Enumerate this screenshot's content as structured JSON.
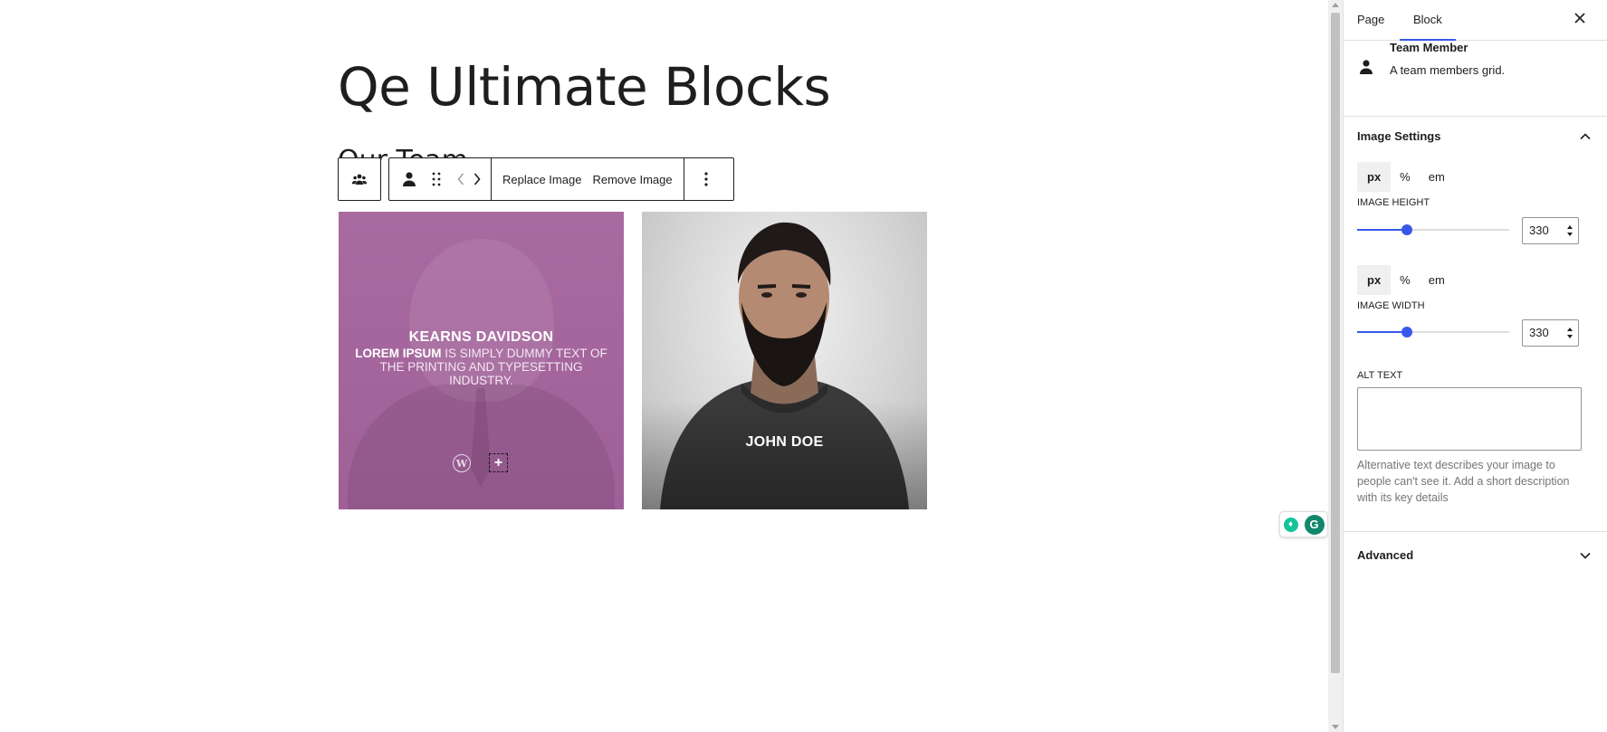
{
  "editor": {
    "page_title": "Qe Ultimate Blocks",
    "subheading": "Our Team"
  },
  "toolbar": {
    "parent_icon": "team-group-icon",
    "block_icon": "person-icon",
    "drag_icon": "drag-handle-icon",
    "replace_label": "Replace Image",
    "remove_label": "Remove Image",
    "more_icon": "more-vertical-icon"
  },
  "team": {
    "members": [
      {
        "name": "KEARNS DAVIDSON",
        "desc_bold": "LOREM IPSUM",
        "desc_rest": " IS SIMPLY DUMMY TEXT OF THE PRINTING AND TYPESETTING INDUSTRY.",
        "social_icon": "wordpress-icon",
        "overlay_color": "#a2659c"
      },
      {
        "name": "JOHN DOE"
      }
    ]
  },
  "sidebar": {
    "tabs": [
      "Page",
      "Block"
    ],
    "active_tab": "Block",
    "block": {
      "name": "Team Member",
      "description": "A team members grid."
    },
    "image_settings": {
      "title": "Image Settings",
      "units": [
        "px",
        "%",
        "em"
      ],
      "height_label": "IMAGE HEIGHT",
      "height_value": "330",
      "height_unit": "px",
      "width_label": "IMAGE WIDTH",
      "width_value": "330",
      "width_unit": "px",
      "alt_label": "ALT TEXT",
      "alt_value": "",
      "alt_help": "Alternative text describes your image to people can't see it. Add a short description with its key details"
    },
    "advanced": {
      "title": "Advanced"
    }
  },
  "accent_color": "#3858e9"
}
